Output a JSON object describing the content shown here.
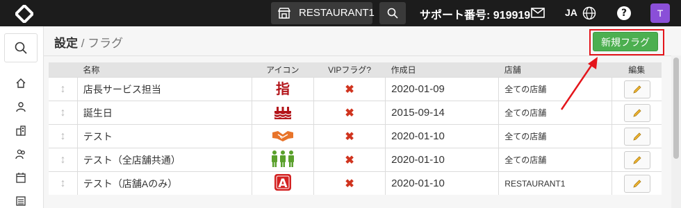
{
  "topbar": {
    "store_label": "RESTAURANT1",
    "support_label": "サポート番号: 919919",
    "lang": "JA",
    "help": "?",
    "avatar_initial": "T"
  },
  "page": {
    "title_main": "設定",
    "title_sep": " / ",
    "title_sub": "フラグ",
    "new_button": "新規フラグ"
  },
  "table": {
    "headers": {
      "name": "名称",
      "icon": "アイコン",
      "vip": "VIPフラグ?",
      "date": "作成日",
      "store": "店舗",
      "edit": "編集"
    },
    "rows": [
      {
        "name": "店長サービス担当",
        "icon": "finger-kanji-icon",
        "vip": "✖",
        "date": "2020-01-09",
        "store": "全ての店舗"
      },
      {
        "name": "誕生日",
        "icon": "cake-icon",
        "vip": "✖",
        "date": "2015-09-14",
        "store": "全ての店舗"
      },
      {
        "name": "テスト",
        "icon": "handshake-icon",
        "vip": "✖",
        "date": "2020-01-10",
        "store": "全ての店舗"
      },
      {
        "name": "テスト（全店舗共通）",
        "icon": "people-group-icon",
        "vip": "✖",
        "date": "2020-01-10",
        "store": "全ての店舗"
      },
      {
        "name": "テスト（店舗Aのみ）",
        "icon": "letter-a-icon",
        "vip": "✖",
        "date": "2020-01-10",
        "store": "RESTAURANT1"
      }
    ]
  },
  "colors": {
    "accent_green": "#4caf50",
    "highlight_red": "#e4151b",
    "vip_x": "#d0341f"
  }
}
